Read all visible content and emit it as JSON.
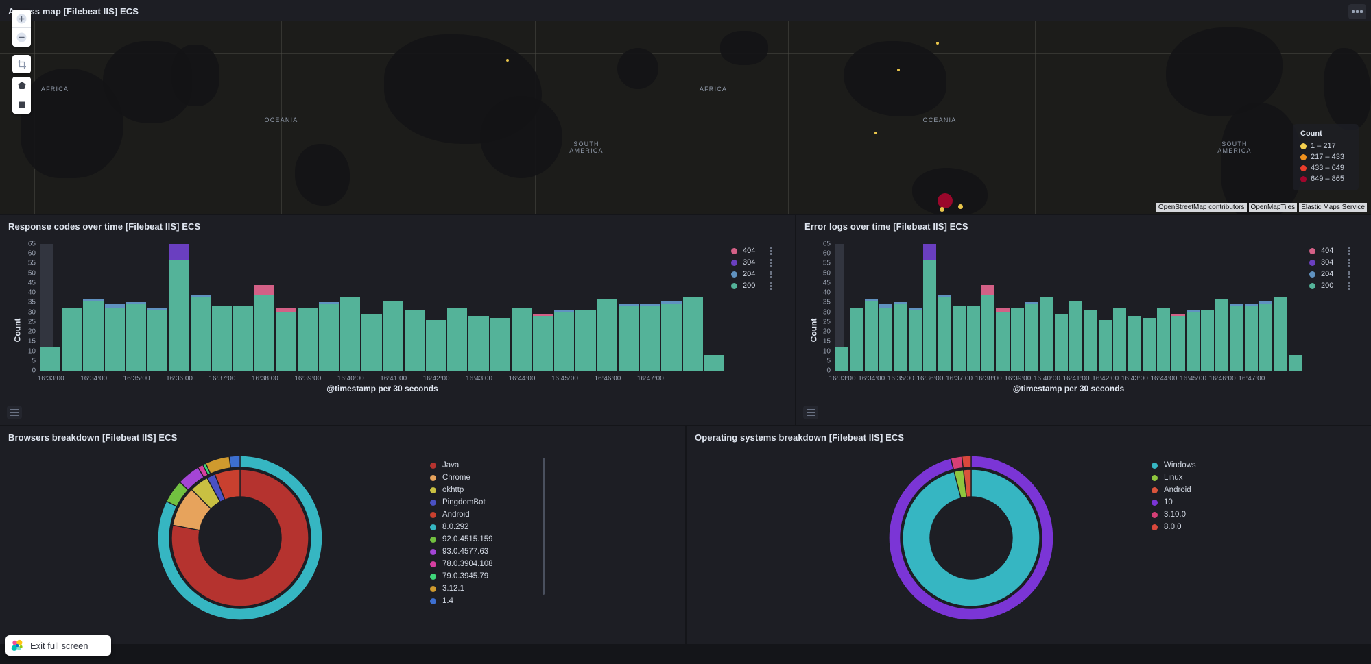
{
  "map_panel": {
    "title": "Access map [Filebeat IIS] ECS",
    "controls": [
      {
        "name": "zoom-in-icon",
        "glyph": "+"
      },
      {
        "name": "zoom-out-icon",
        "glyph": "−"
      },
      {
        "name": "fit-to-data-icon",
        "glyph": "crop"
      },
      {
        "name": "draw-polygon-icon",
        "glyph": "polygon"
      },
      {
        "name": "draw-bounds-icon",
        "glyph": "square"
      }
    ],
    "legend": {
      "title": "Count",
      "items": [
        {
          "label": "1 – 217",
          "color": "#f5d04e"
        },
        {
          "label": "217 – 433",
          "color": "#f0921e"
        },
        {
          "label": "433 – 649",
          "color": "#eb3d2b"
        },
        {
          "label": "649 – 865",
          "color": "#a1062c"
        }
      ]
    },
    "continent_labels": [
      "AFRICA",
      "AFRICA",
      "OCEANIA",
      "OCEANIA",
      "SOUTH AMERICA",
      "SOUTH AMERICA"
    ],
    "attribution": [
      "OpenStreetMap contributors",
      "OpenMapTiles",
      "Elastic Maps Service"
    ],
    "markers": [
      {
        "color": "#f5d04e",
        "size": 4,
        "x": 740,
        "y": 58
      },
      {
        "color": "#f5d04e",
        "size": 4,
        "x": 1367,
        "y": 33
      },
      {
        "color": "#f5d04e",
        "size": 4,
        "x": 1310,
        "y": 72
      },
      {
        "color": "#f5d04e",
        "size": 4,
        "x": 1277,
        "y": 164
      },
      {
        "color": "#a1062c",
        "size": 22,
        "x": 1378,
        "y": 263
      },
      {
        "color": "#f5d04e",
        "size": 7,
        "x": 1400,
        "y": 271
      },
      {
        "color": "#f5d04e",
        "size": 7,
        "x": 1373,
        "y": 275
      }
    ]
  },
  "response_panel": {
    "title": "Response codes over time [Filebeat IIS] ECS",
    "legend_toggle": "legend-toggle"
  },
  "error_panel": {
    "title": "Error logs over time [Filebeat IIS] ECS",
    "legend_toggle": "legend-toggle"
  },
  "browsers_panel": {
    "title": "Browsers breakdown [Filebeat IIS] ECS"
  },
  "os_panel": {
    "title": "Operating systems breakdown [Filebeat IIS] ECS"
  },
  "footer": {
    "exit_full_screen_label": "Exit full screen"
  },
  "chart_data": [
    {
      "id": "response-codes",
      "type": "bar",
      "stacked": true,
      "title": "Response codes over time [Filebeat IIS] ECS",
      "xlabel": "@timestamp per 30 seconds",
      "ylabel": "Count",
      "ylim": [
        0,
        65
      ],
      "yticks": [
        0,
        5,
        10,
        15,
        20,
        25,
        30,
        35,
        40,
        45,
        50,
        55,
        60,
        65
      ],
      "grid": false,
      "legend_position": "right",
      "xtick_labels": [
        "16:33:00",
        "16:34:00",
        "16:35:00",
        "16:36:00",
        "16:37:00",
        "16:38:00",
        "16:39:00",
        "16:40:00",
        "16:41:00",
        "16:42:00",
        "16:43:00",
        "16:44:00",
        "16:45:00",
        "16:46:00",
        "16:47:00"
      ],
      "series": [
        {
          "name": "200",
          "color": "#54b399",
          "values": [
            12,
            32,
            36,
            32,
            34,
            31,
            57,
            38,
            33,
            33,
            39,
            30,
            32,
            34,
            38,
            29,
            36,
            31,
            26,
            32,
            28,
            27,
            32,
            28,
            30,
            31,
            37,
            33,
            33,
            34,
            38,
            8
          ]
        },
        {
          "name": "204",
          "color": "#6092c0",
          "values": [
            0,
            0,
            1,
            2,
            1,
            1,
            0,
            1,
            0,
            0,
            0,
            0,
            0,
            1,
            0,
            0,
            0,
            0,
            0,
            0,
            0,
            0,
            0,
            0,
            1,
            0,
            0,
            1,
            1,
            2,
            0
          ]
        },
        {
          "name": "304",
          "color": "#6a3fc0",
          "values": [
            0,
            0,
            0,
            0,
            0,
            0,
            8,
            0,
            0,
            0,
            0,
            0,
            0,
            0,
            0,
            0,
            0,
            0,
            0,
            0,
            0,
            0,
            0,
            0,
            0,
            0,
            0,
            0,
            0,
            0,
            0
          ]
        },
        {
          "name": "404",
          "color": "#d36086",
          "values": [
            0,
            0,
            0,
            0,
            0,
            0,
            0,
            0,
            0,
            0,
            5,
            2,
            0,
            0,
            0,
            0,
            0,
            0,
            0,
            0,
            0,
            0,
            0,
            1,
            0,
            0,
            0,
            0,
            0,
            0,
            0
          ]
        }
      ],
      "legend_entries": [
        "404",
        "304",
        "204",
        "200"
      ]
    },
    {
      "id": "error-logs",
      "type": "bar",
      "stacked": true,
      "title": "Error logs over time [Filebeat IIS] ECS",
      "xlabel": "@timestamp per 30 seconds",
      "ylabel": "Count",
      "ylim": [
        0,
        65
      ],
      "yticks": [
        0,
        5,
        10,
        15,
        20,
        25,
        30,
        35,
        40,
        45,
        50,
        55,
        60,
        65
      ],
      "grid": false,
      "legend_position": "right",
      "xtick_labels": [
        "16:33:00",
        "16:34:00",
        "16:35:00",
        "16:36:00",
        "16:37:00",
        "16:38:00",
        "16:39:00",
        "16:40:00",
        "16:41:00",
        "16:42:00",
        "16:43:00",
        "16:44:00",
        "16:45:00",
        "16:46:00",
        "16:47:00"
      ],
      "series": [
        {
          "name": "200",
          "color": "#54b399",
          "values": [
            12,
            32,
            36,
            32,
            34,
            31,
            57,
            38,
            33,
            33,
            39,
            30,
            32,
            34,
            38,
            29,
            36,
            31,
            26,
            32,
            28,
            27,
            32,
            28,
            30,
            31,
            37,
            33,
            33,
            34,
            38,
            8
          ]
        },
        {
          "name": "204",
          "color": "#6092c0",
          "values": [
            0,
            0,
            1,
            2,
            1,
            1,
            0,
            1,
            0,
            0,
            0,
            0,
            0,
            1,
            0,
            0,
            0,
            0,
            0,
            0,
            0,
            0,
            0,
            0,
            1,
            0,
            0,
            1,
            1,
            2,
            0
          ]
        },
        {
          "name": "304",
          "color": "#6a3fc0",
          "values": [
            0,
            0,
            0,
            0,
            0,
            0,
            8,
            0,
            0,
            0,
            0,
            0,
            0,
            0,
            0,
            0,
            0,
            0,
            0,
            0,
            0,
            0,
            0,
            0,
            0,
            0,
            0,
            0,
            0,
            0,
            0
          ]
        },
        {
          "name": "404",
          "color": "#d36086",
          "values": [
            0,
            0,
            0,
            0,
            0,
            0,
            0,
            0,
            0,
            0,
            5,
            2,
            0,
            0,
            0,
            0,
            0,
            0,
            0,
            0,
            0,
            0,
            0,
            1,
            0,
            0,
            0,
            0,
            0,
            0,
            0
          ]
        }
      ],
      "legend_entries": [
        "404",
        "304",
        "204",
        "200"
      ]
    },
    {
      "id": "browsers-breakdown",
      "type": "pie",
      "variant": "donut-sunburst",
      "title": "Browsers breakdown [Filebeat IIS] ECS",
      "legend_position": "right",
      "rings": [
        {
          "name": "inner",
          "slices": [
            {
              "label": "Java",
              "color": "#b5332f",
              "value": 78.0
            },
            {
              "label": "Chrome",
              "color": "#e7a35c",
              "value": 9.5
            },
            {
              "label": "okhttp",
              "color": "#c9c042",
              "value": 4.5
            },
            {
              "label": "PingdomBot",
              "color": "#4a51c4",
              "value": 2.0
            },
            {
              "label": "Android",
              "color": "#c9402f",
              "value": 6.0
            }
          ]
        },
        {
          "name": "outer",
          "slices": [
            {
              "label": "8.0.292",
              "color": "#36b6c2",
              "value": 78.0
            },
            {
              "label": "92.0.4515.159",
              "color": "#72c040",
              "value": 4.3
            },
            {
              "label": "93.0.4577.63",
              "color": "#a445d6",
              "value": 4.3
            },
            {
              "label": "78.0.3904.108",
              "color": "#d63fa0",
              "value": 1.0
            },
            {
              "label": "79.0.3945.79",
              "color": "#3fd67a",
              "value": 0.6
            },
            {
              "label": "3.12.1",
              "color": "#cf9a2e",
              "value": 4.5
            },
            {
              "label": "1.4",
              "color": "#3d6fd0",
              "value": 2.0
            }
          ]
        }
      ],
      "legend_entries": [
        {
          "label": "Java",
          "color": "#b5332f"
        },
        {
          "label": "Chrome",
          "color": "#e7a35c"
        },
        {
          "label": "okhttp",
          "color": "#c9c042"
        },
        {
          "label": "PingdomBot",
          "color": "#4a51c4"
        },
        {
          "label": "Android",
          "color": "#c9402f"
        },
        {
          "label": "8.0.292",
          "color": "#36b6c2"
        },
        {
          "label": "92.0.4515.159",
          "color": "#72c040"
        },
        {
          "label": "93.0.4577.63",
          "color": "#a445d6"
        },
        {
          "label": "78.0.3904.108",
          "color": "#d63fa0"
        },
        {
          "label": "79.0.3945.79",
          "color": "#3fd67a"
        },
        {
          "label": "3.12.1",
          "color": "#cf9a2e"
        },
        {
          "label": "1.4",
          "color": "#3d6fd0"
        }
      ]
    },
    {
      "id": "os-breakdown",
      "type": "pie",
      "variant": "donut-sunburst",
      "title": "Operating systems breakdown [Filebeat IIS] ECS",
      "legend_position": "right",
      "rings": [
        {
          "name": "inner",
          "slices": [
            {
              "label": "Windows",
              "color": "#36b6c2",
              "value": 96.0
            },
            {
              "label": "Linux",
              "color": "#8fc63e",
              "value": 2.2
            },
            {
              "label": "Android",
              "color": "#d9543c",
              "value": 1.8
            }
          ]
        },
        {
          "name": "outer",
          "slices": [
            {
              "label": "10",
              "color": "#7b35d6",
              "value": 96.0
            },
            {
              "label": "3.10.0",
              "color": "#d63f76",
              "value": 2.2
            },
            {
              "label": "8.0.0",
              "color": "#d9483c",
              "value": 1.8
            }
          ]
        }
      ],
      "legend_entries": [
        {
          "label": "Windows",
          "color": "#36b6c2"
        },
        {
          "label": "Linux",
          "color": "#8fc63e"
        },
        {
          "label": "Android",
          "color": "#d9543c"
        },
        {
          "label": "10",
          "color": "#7b35d6"
        },
        {
          "label": "3.10.0",
          "color": "#d63f76"
        },
        {
          "label": "8.0.0",
          "color": "#d9483c"
        }
      ]
    }
  ]
}
